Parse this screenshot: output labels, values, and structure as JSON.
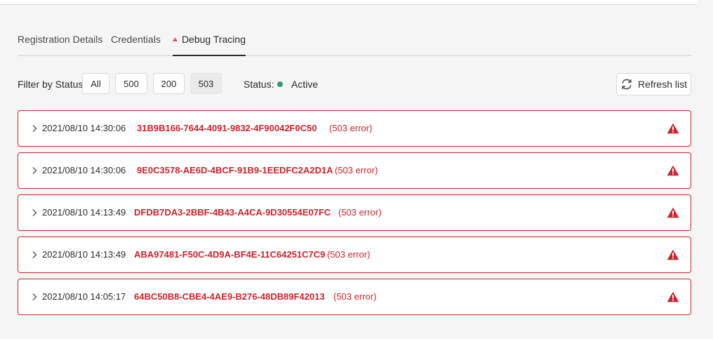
{
  "tabs": [
    {
      "label": "Registration Details",
      "selected": false
    },
    {
      "label": "Credentials",
      "selected": false
    },
    {
      "label": "Debug Tracing",
      "selected": true,
      "icon": "alert-icon"
    }
  ],
  "filter": {
    "label": "Filter by Status:",
    "options": [
      "All",
      "500",
      "200",
      "503"
    ],
    "selected": "503"
  },
  "status": {
    "label": "Status:",
    "value": "Active",
    "dot_color": "#2d9d78"
  },
  "refresh": {
    "label": "Refresh list",
    "icon": "refresh-icon"
  },
  "traces": [
    {
      "timestamp": "2021/08/10 14:30:06",
      "trace_id": "31B9B166-7644-4091-9832-4F90042F0C50",
      "error": "(503 error)"
    },
    {
      "timestamp": "2021/08/10 14:30:06",
      "trace_id": "9E0C3578-AE6D-4BCF-91B9-1EEDFC2A2D1A",
      "error": "(503 error)"
    },
    {
      "timestamp": "2021/08/10 14:13:49",
      "trace_id": "DFDB7DA3-2BBF-4B43-A4CA-9D30554E07FC",
      "error": "(503 error)"
    },
    {
      "timestamp": "2021/08/10 14:13:49",
      "trace_id": "ABA97481-F50C-4D9A-BF4E-11C64251C7C9",
      "error": "(503 error)"
    },
    {
      "timestamp": "2021/08/10 14:05:17",
      "trace_id": "64BC50B8-CBE4-4AE9-B276-48DB89F42013",
      "error": "(503 error)"
    }
  ],
  "colors": {
    "error": "#c9252d",
    "active": "#2d9d78",
    "background": "#f5f5f5"
  }
}
